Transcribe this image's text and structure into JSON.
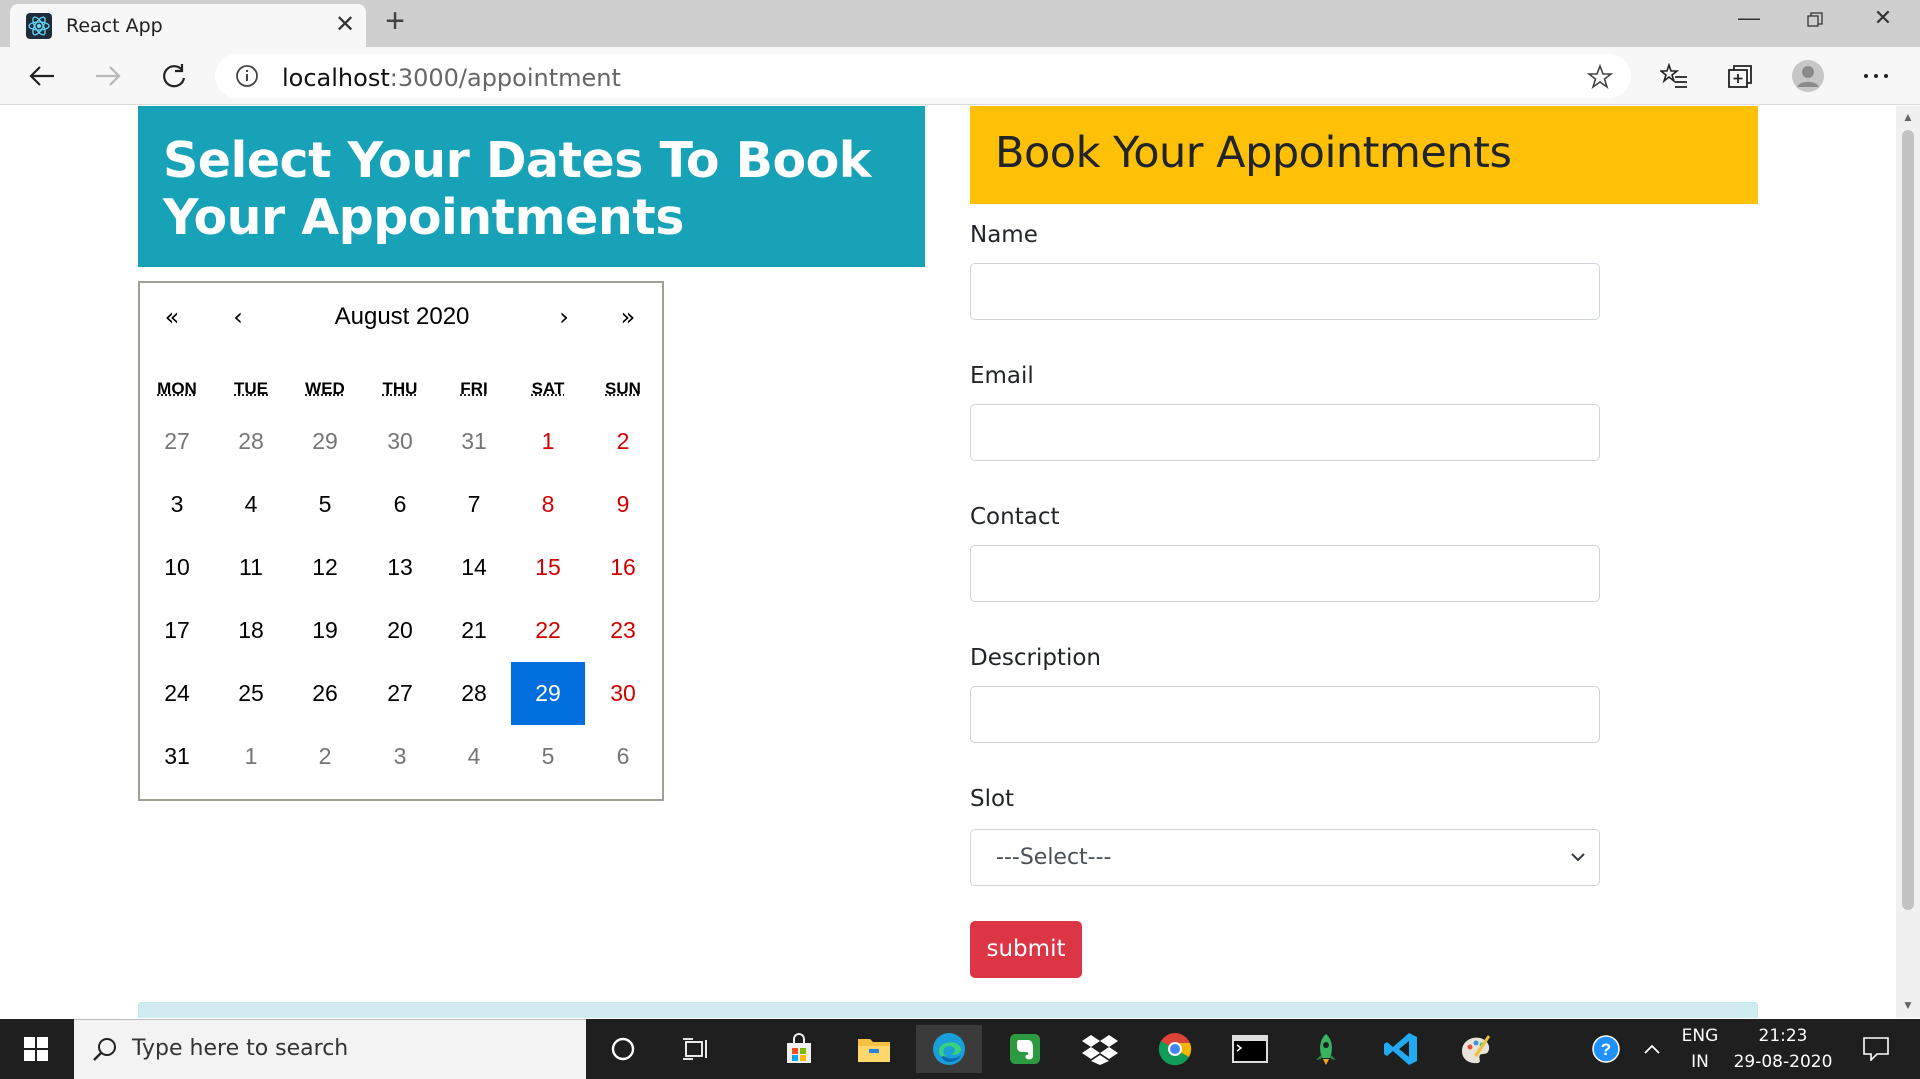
{
  "browser": {
    "tab_title": "React App",
    "url_host": "localhost",
    "url_path": ":3000/appointment"
  },
  "left_panel": {
    "title": "Select Your Dates To Book Your Appointments"
  },
  "calendar": {
    "nav_prev_year": "«",
    "nav_prev_month": "‹",
    "nav_next_month": "›",
    "nav_next_year": "»",
    "month_label": "August 2020",
    "weekdays": [
      "MON",
      "TUE",
      "WED",
      "THU",
      "FRI",
      "SAT",
      "SUN"
    ],
    "weeks": [
      [
        "27",
        "28",
        "29",
        "30",
        "31",
        "1",
        "2"
      ],
      [
        "3",
        "4",
        "5",
        "6",
        "7",
        "8",
        "9"
      ],
      [
        "10",
        "11",
        "12",
        "13",
        "14",
        "15",
        "16"
      ],
      [
        "17",
        "18",
        "19",
        "20",
        "21",
        "22",
        "23"
      ],
      [
        "24",
        "25",
        "26",
        "27",
        "28",
        "29",
        "30"
      ],
      [
        "31",
        "1",
        "2",
        "3",
        "4",
        "5",
        "6"
      ]
    ],
    "selected_day": "29",
    "weekend_color": "#d10000",
    "selected_color": "#006edc"
  },
  "form": {
    "title": "Book Your Appointments",
    "name_label": "Name",
    "email_label": "Email",
    "contact_label": "Contact",
    "description_label": "Description",
    "slot_label": "Slot",
    "slot_selected": "---Select---",
    "submit_label": "submit"
  },
  "taskbar": {
    "search_placeholder": "Type here to search",
    "lang_line1": "ENG",
    "lang_line2": "IN",
    "time": "21:23",
    "date": "29-08-2020"
  },
  "colors": {
    "left_header": "#17a2b8",
    "right_header": "#ffc107",
    "submit_button": "#dc3545"
  }
}
